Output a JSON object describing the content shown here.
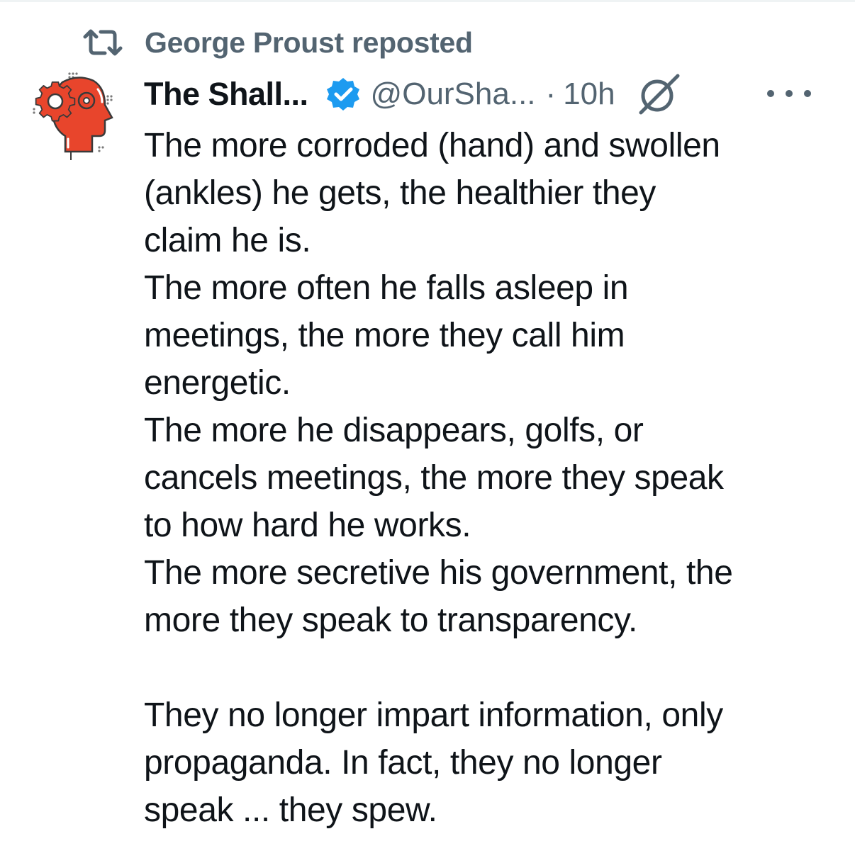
{
  "repost": {
    "icon": "repost-icon",
    "text": "George Proust reposted"
  },
  "author": {
    "avatar_icon": "gear-head-avatar",
    "display_name": "The Shall...",
    "verified_icon": "verified-badge-icon",
    "handle": "@OurSha...",
    "separator": "·",
    "time": "10h",
    "grok_icon": "grok-icon",
    "more_icon": "more-options-icon"
  },
  "tweet": {
    "lines": [
      "The more corroded (hand) and swollen",
      "(ankles) he gets, the healthier they",
      "claim he is.",
      "The more often he falls asleep in",
      "meetings, the more they call him",
      "energetic.",
      "The more he disappears, golfs, or",
      "cancels meetings, the more they speak",
      "to how hard he works.",
      "The more secretive his government, the",
      "more they speak to transparency.",
      "",
      "They no longer impart information, only",
      "propaganda. In fact, they no longer",
      "speak ... they spew."
    ]
  },
  "colors": {
    "text_primary": "#0f1419",
    "text_secondary": "#536471",
    "verified_blue": "#1d9bf0",
    "avatar_red": "#e8452c"
  }
}
